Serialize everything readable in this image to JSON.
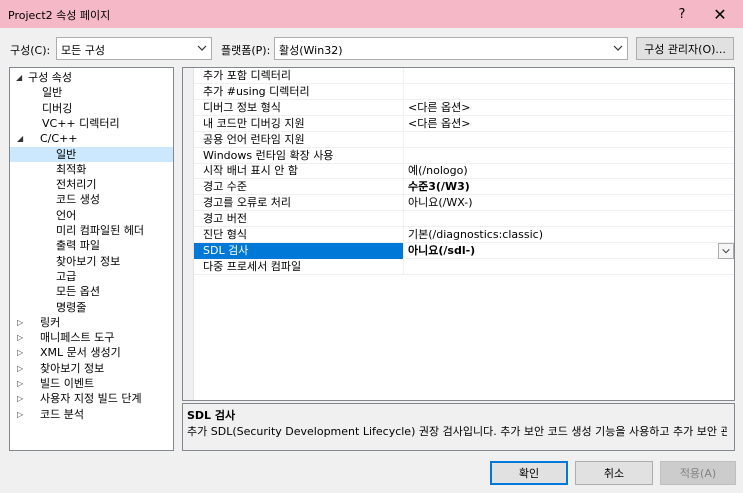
{
  "window": {
    "title": "Project2 속성 페이지",
    "help_glyph": "?",
    "close_glyph": "✕"
  },
  "toolbar": {
    "config_label": "구성(C):",
    "config_value": "모든 구성",
    "platform_label": "플랫폼(P):",
    "platform_value": "활성(Win32)",
    "config_manager_label": "구성 관리자(O)..."
  },
  "tree": {
    "items": [
      {
        "label": "구성 속성",
        "level": 0,
        "expander": "◢"
      },
      {
        "label": "일반",
        "level": 1,
        "expander": ""
      },
      {
        "label": "디버깅",
        "level": 1,
        "expander": ""
      },
      {
        "label": "VC++ 디렉터리",
        "level": 1,
        "expander": ""
      },
      {
        "label": "C/C++",
        "level": 1,
        "expander": "◢"
      },
      {
        "label": "일반",
        "level": 2,
        "expander": "",
        "selected": true
      },
      {
        "label": "최적화",
        "level": 2,
        "expander": ""
      },
      {
        "label": "전처리기",
        "level": 2,
        "expander": ""
      },
      {
        "label": "코드 생성",
        "level": 2,
        "expander": ""
      },
      {
        "label": "언어",
        "level": 2,
        "expander": ""
      },
      {
        "label": "미리 컴파일된 헤더",
        "level": 2,
        "expander": ""
      },
      {
        "label": "출력 파일",
        "level": 2,
        "expander": ""
      },
      {
        "label": "찾아보기 정보",
        "level": 2,
        "expander": ""
      },
      {
        "label": "고급",
        "level": 2,
        "expander": ""
      },
      {
        "label": "모든 옵션",
        "level": 2,
        "expander": ""
      },
      {
        "label": "명령줄",
        "level": 2,
        "expander": ""
      },
      {
        "label": "링커",
        "level": 1,
        "expander": "▷"
      },
      {
        "label": "매니페스트 도구",
        "level": 1,
        "expander": "▷"
      },
      {
        "label": "XML 문서 생성기",
        "level": 1,
        "expander": "▷"
      },
      {
        "label": "찾아보기 정보",
        "level": 1,
        "expander": "▷"
      },
      {
        "label": "빌드 이벤트",
        "level": 1,
        "expander": "▷"
      },
      {
        "label": "사용자 지정 빌드 단계",
        "level": 1,
        "expander": "▷"
      },
      {
        "label": "코드 분석",
        "level": 1,
        "expander": "▷"
      }
    ]
  },
  "grid": {
    "rows": [
      {
        "name": "추가 포함 디렉터리",
        "value": ""
      },
      {
        "name": "추가 #using 디렉터리",
        "value": ""
      },
      {
        "name": "디버그 정보 형식",
        "value": "<다른 옵션>"
      },
      {
        "name": "내 코드만 디버깅 지원",
        "value": "<다른 옵션>"
      },
      {
        "name": "공용 언어 런타임 지원",
        "value": ""
      },
      {
        "name": "Windows 런타임 확장 사용",
        "value": ""
      },
      {
        "name": "시작 배너 표시 안 함",
        "value": "예(/nologo)"
      },
      {
        "name": "경고 수준",
        "value": "수준3(/W3)",
        "bold": true
      },
      {
        "name": "경고를 오류로 처리",
        "value": "아니요(/WX-)"
      },
      {
        "name": "경고 버전",
        "value": ""
      },
      {
        "name": "진단 형식",
        "value": "기본(/diagnostics:classic)"
      },
      {
        "name": "SDL 검사",
        "value": "아니요(/sdl-)",
        "bold": true,
        "selected": true
      },
      {
        "name": "다중 프로세서 컴파일",
        "value": ""
      }
    ]
  },
  "description": {
    "title": "SDL 검사",
    "text": "추가 SDL(Security Development Lifecycle) 권장 검사입니다. 추가 보안 코드 생성 기능을 사용하고 추가 보안 관련 ..."
  },
  "footer": {
    "ok_label": "확인",
    "cancel_label": "취소",
    "apply_label": "적용(A)"
  },
  "colors": {
    "titlebar": "#f5b8c6",
    "selection": "#0078d7",
    "tree_selection": "#cce8ff"
  }
}
